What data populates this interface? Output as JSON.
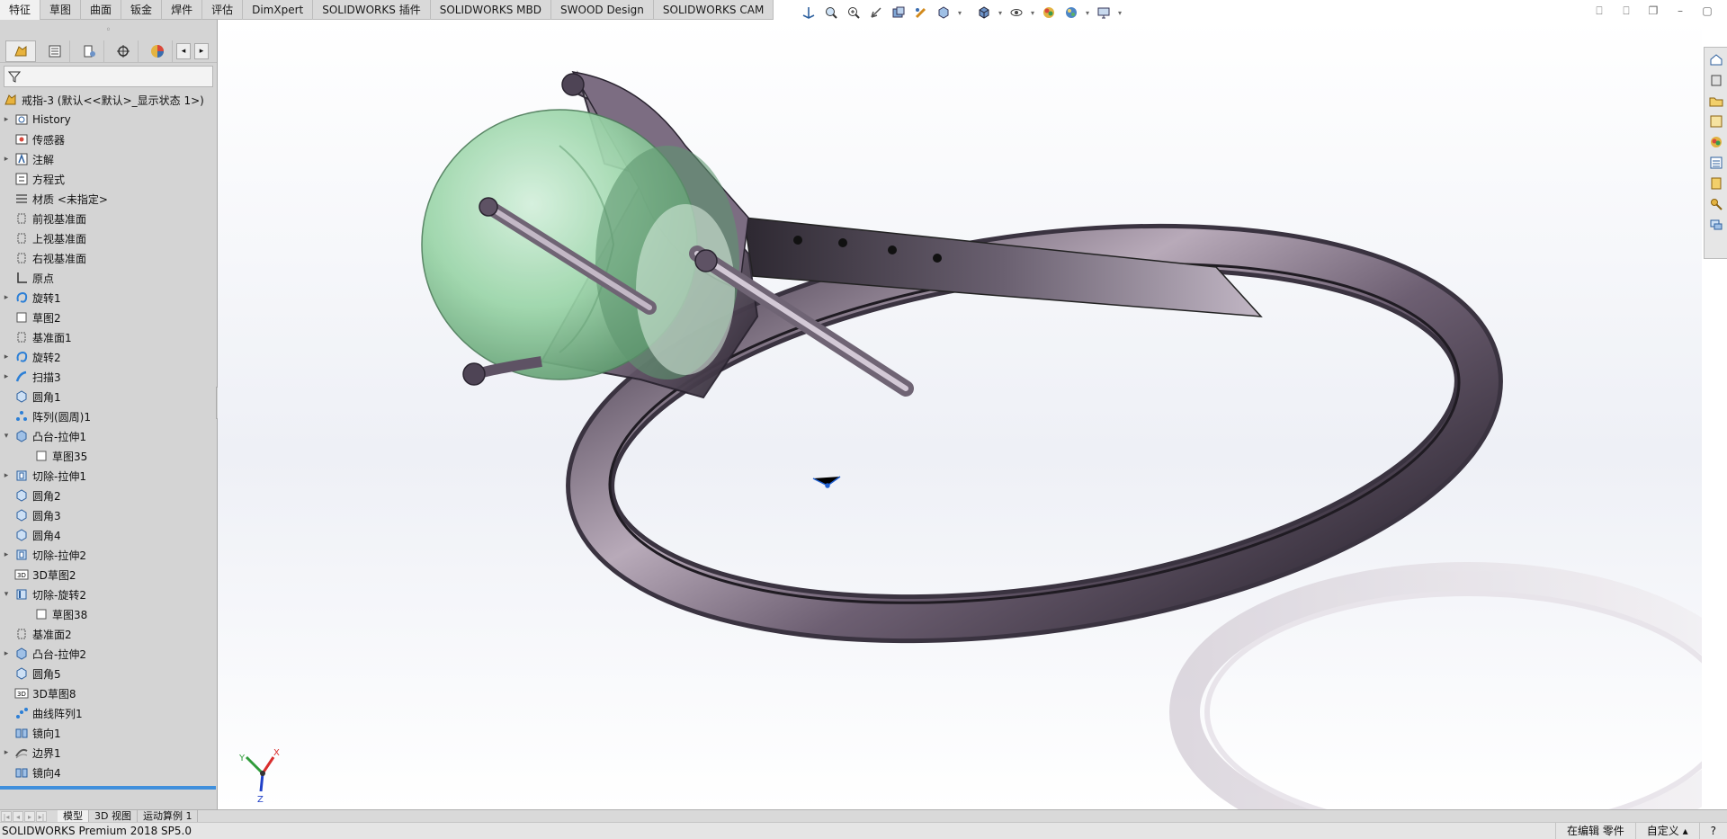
{
  "command_tabs": [
    "特征",
    "草图",
    "曲面",
    "钣金",
    "焊件",
    "评估",
    "DimXpert",
    "SOLIDWORKS 插件",
    "SOLIDWORKS MBD",
    "SWOOD Design",
    "SOLIDWORKS CAM"
  ],
  "active_tab_index": 0,
  "hud_icons": [
    "view-orientation-icon",
    "zoom-to-fit-icon",
    "zoom-area-icon",
    "previous-view-icon",
    "section-view-icon",
    "dynamic-annotation-icon",
    "view-orientation-cube-icon",
    "display-style-icon",
    "hide-show-icon",
    "edit-appearance-icon",
    "apply-scene-icon",
    "view-settings-icon"
  ],
  "feature_tree": {
    "root_label": "戒指-3 (默认<<默认>_显示状态 1>)",
    "items": [
      {
        "label": "History",
        "icon": "history-folder-icon",
        "expander": true
      },
      {
        "label": "传感器",
        "icon": "sensor-icon",
        "expander": false
      },
      {
        "label": "注解",
        "icon": "annotation-icon",
        "expander": true
      },
      {
        "label": "方程式",
        "icon": "equation-icon",
        "expander": false
      },
      {
        "label": "材质 <未指定>",
        "icon": "material-icon",
        "expander": false
      },
      {
        "label": "前视基准面",
        "icon": "plane-icon",
        "expander": false
      },
      {
        "label": "上视基准面",
        "icon": "plane-icon",
        "expander": false
      },
      {
        "label": "右视基准面",
        "icon": "plane-icon",
        "expander": false
      },
      {
        "label": "原点",
        "icon": "origin-icon",
        "expander": false
      },
      {
        "label": "旋转1",
        "icon": "revolve-icon",
        "expander": true
      },
      {
        "label": "草图2",
        "icon": "sketch-icon",
        "expander": false
      },
      {
        "label": "基准面1",
        "icon": "plane-icon",
        "expander": false
      },
      {
        "label": "旋转2",
        "icon": "revolve-icon",
        "expander": true
      },
      {
        "label": "扫描3",
        "icon": "sweep-icon",
        "expander": true
      },
      {
        "label": "圆角1",
        "icon": "fillet-icon",
        "expander": false
      },
      {
        "label": "阵列(圆周)1",
        "icon": "circular-pattern-icon",
        "expander": false
      },
      {
        "label": "凸台-拉伸1",
        "icon": "boss-extrude-icon",
        "expander": true,
        "expanded": true
      },
      {
        "label": "草图35",
        "icon": "sketch-icon",
        "expander": false,
        "child": true
      },
      {
        "label": "切除-拉伸1",
        "icon": "cut-extrude-icon",
        "expander": true
      },
      {
        "label": "圆角2",
        "icon": "fillet-icon",
        "expander": false
      },
      {
        "label": "圆角3",
        "icon": "fillet-icon",
        "expander": false
      },
      {
        "label": "圆角4",
        "icon": "fillet-icon",
        "expander": false
      },
      {
        "label": "切除-拉伸2",
        "icon": "cut-extrude-icon",
        "expander": true
      },
      {
        "label": "3D草图2",
        "icon": "3d-sketch-icon",
        "expander": false
      },
      {
        "label": "切除-旋转2",
        "icon": "cut-revolve-icon",
        "expander": true,
        "expanded": true
      },
      {
        "label": "草图38",
        "icon": "sketch-icon",
        "expander": false,
        "child": true
      },
      {
        "label": "基准面2",
        "icon": "plane-icon",
        "expander": false
      },
      {
        "label": "凸台-拉伸2",
        "icon": "boss-extrude-icon",
        "expander": true
      },
      {
        "label": "圆角5",
        "icon": "fillet-icon",
        "expander": false
      },
      {
        "label": "3D草图8",
        "icon": "3d-sketch-icon",
        "expander": false
      },
      {
        "label": "曲线阵列1",
        "icon": "curve-pattern-icon",
        "expander": false
      },
      {
        "label": "镜向1",
        "icon": "mirror-icon",
        "expander": false
      },
      {
        "label": "边界1",
        "icon": "boundary-icon",
        "expander": true
      },
      {
        "label": "镜向4",
        "icon": "mirror-icon",
        "expander": false
      }
    ]
  },
  "bottom_tabs": [
    "模型",
    "3D 视图",
    "运动算例 1"
  ],
  "active_bottom_tab_index": 0,
  "status": {
    "version": "SOLIDWORKS Premium 2018 SP5.0",
    "mode": "在编辑 零件",
    "units": "自定义"
  },
  "triad_labels": {
    "x": "X",
    "y": "Y",
    "z": "Z"
  },
  "colors": {
    "accent_blue": "#3f8fdc",
    "gem_green": "#8fd7a0",
    "metal": "#8a7c8f"
  }
}
